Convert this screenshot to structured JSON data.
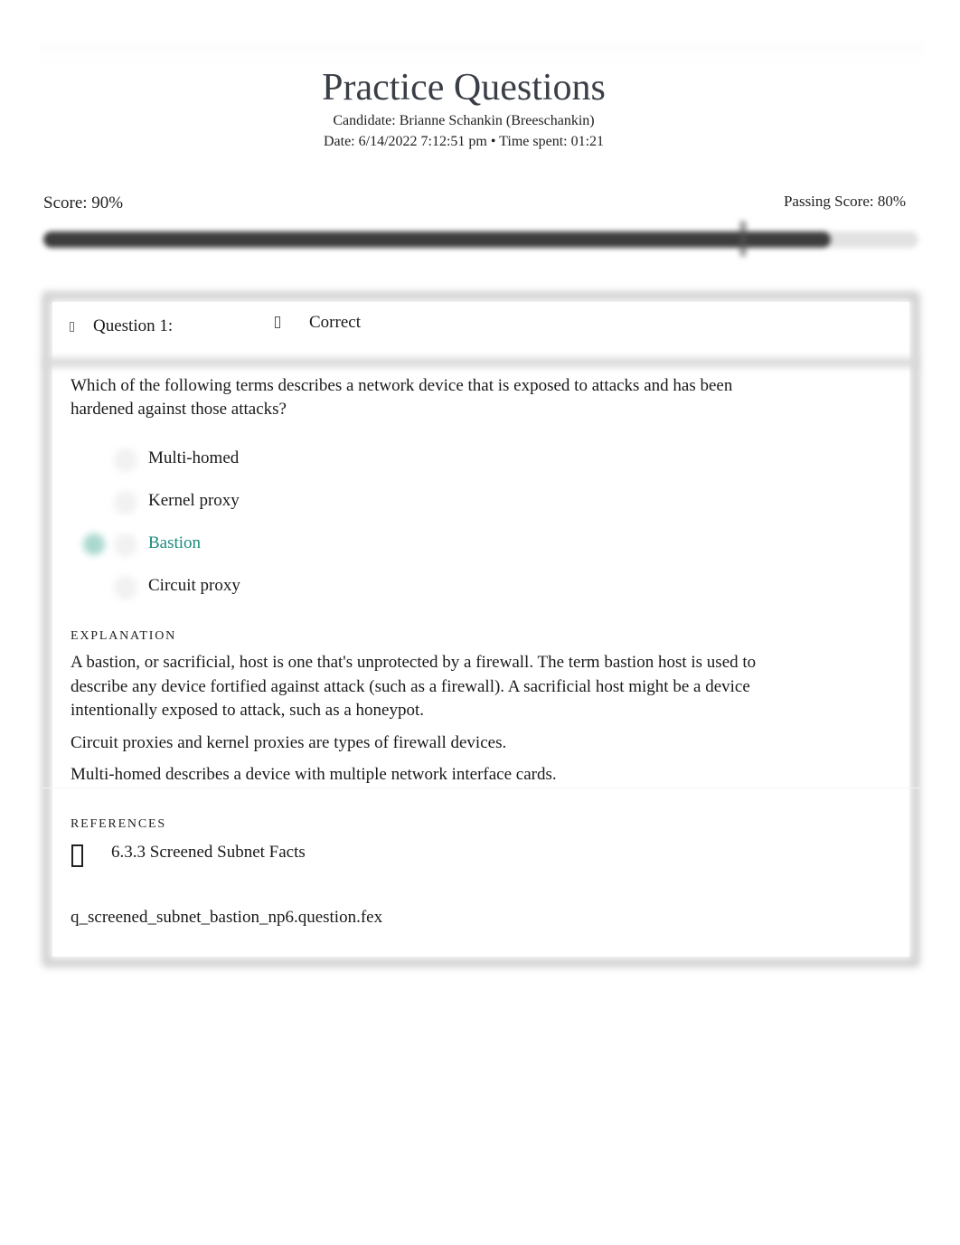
{
  "header": {
    "title": "Practice Questions",
    "candidate": "Candidate: Brianne Schankin (Breeschankin)",
    "date_time": "Date: 6/14/2022 7:12:51 pm • Time spent: 01:21"
  },
  "score": {
    "label": "Score: 90%",
    "value_percent": 90,
    "passing_label": "Passing Score: 80%",
    "passing_percent": 80,
    "colors": {
      "fill": "#3d3d3d",
      "track": "#e2e2e2"
    }
  },
  "question": {
    "number_label": "Question 1:",
    "status": "Correct",
    "icons": {
      "collapse": "chevron-icon",
      "status": "check-circle-icon"
    },
    "text": "Which of the following terms describes a network device that is exposed to attacks and has been hardened against those attacks?",
    "answers": [
      {
        "label": "Multi-homed",
        "selected": false,
        "correct": false
      },
      {
        "label": "Kernel proxy",
        "selected": false,
        "correct": false
      },
      {
        "label": "Bastion",
        "selected": true,
        "correct": true
      },
      {
        "label": "Circuit proxy",
        "selected": false,
        "correct": false
      }
    ],
    "correct_color": "#1b8a7e"
  },
  "explanation": {
    "heading": "Explanation",
    "paragraphs": [
      "A bastion, or sacrificial, host is one that's unprotected by a firewall. The term bastion host is used to describe any device fortified against attack (such as a firewall). A sacrificial host might be a device intentionally exposed to attack, such as a honeypot.",
      "Circuit proxies and kernel proxies are types of firewall devices.",
      "Multi-homed describes a device with multiple network interface cards."
    ]
  },
  "references": {
    "heading": "References",
    "items": [
      {
        "icon": "book-icon",
        "label": "6.3.3 Screened Subnet Facts"
      }
    ]
  },
  "question_file": "q_screened_subnet_bastion_np6.question.fex"
}
